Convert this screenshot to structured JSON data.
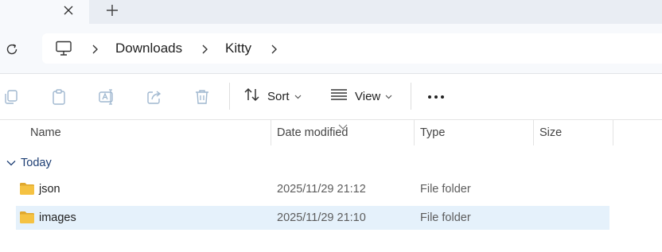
{
  "breadcrumb": {
    "items": [
      "Downloads",
      "Kitty"
    ]
  },
  "toolbar": {
    "sort_label": "Sort",
    "view_label": "View"
  },
  "columns": {
    "name": "Name",
    "date_modified": "Date modified",
    "type": "Type",
    "size": "Size"
  },
  "group": {
    "label": "Today"
  },
  "files": [
    {
      "name": "json",
      "date": "2025/11/29 21:12",
      "type": "File folder",
      "size": "",
      "selected": false
    },
    {
      "name": "images",
      "date": "2025/11/29 21:10",
      "type": "File folder",
      "size": "",
      "selected": true
    }
  ],
  "colors": {
    "folder": "#f5c242",
    "selection": "#e5f1fb",
    "group_text": "#1c3d73",
    "tab_strip": "#e9edf3"
  }
}
